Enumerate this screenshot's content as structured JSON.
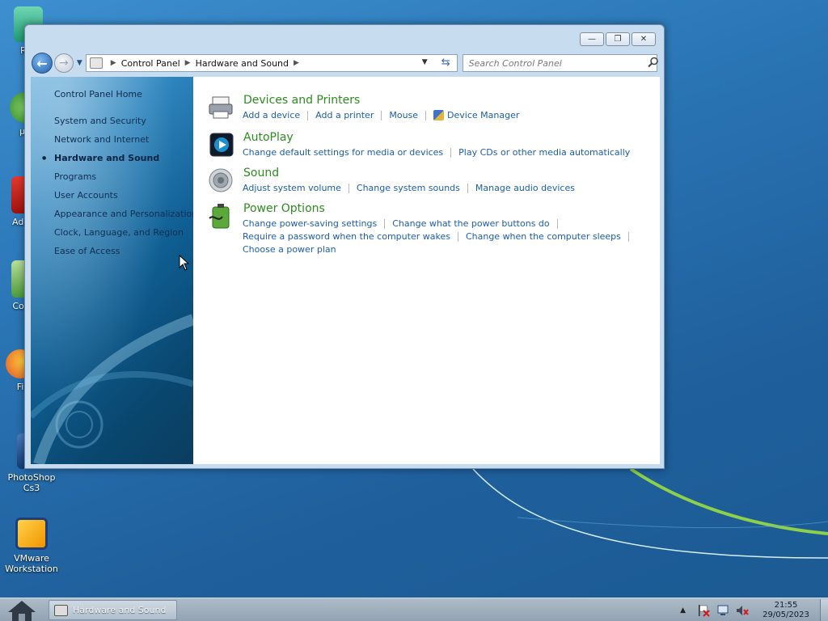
{
  "desktop": {
    "icons": [
      {
        "label": "Rec",
        "color": "#2fb88a"
      },
      {
        "label": "µT",
        "color": "#43a14b"
      },
      {
        "label": "Adob",
        "color": "#c8201c"
      },
      {
        "label": "Colla",
        "color": "#59a84a"
      },
      {
        "label": "Fi",
        "color": "#e8762a"
      },
      {
        "label": "PhotoShop Cs3",
        "color": "#1c4c8a"
      },
      {
        "label": "VMware Workstation",
        "color": "#f2a21a"
      }
    ]
  },
  "window": {
    "controls": {
      "minimize": "—",
      "restore": "❐",
      "close": "✕"
    },
    "address": {
      "crumbs": [
        "Control Panel",
        "Hardware and Sound"
      ]
    },
    "search": {
      "placeholder": "Search Control Panel"
    },
    "left": {
      "home": "Control Panel Home",
      "items": [
        "System and Security",
        "Network and Internet",
        "Hardware and Sound",
        "Programs",
        "User Accounts",
        "Appearance and Personalization",
        "Clock, Language, and Region",
        "Ease of Access"
      ],
      "selected_index": 2
    },
    "categories": [
      {
        "title": "Devices and Printers",
        "icon": "printer-icon",
        "links": [
          [
            "Add a device",
            "Add a printer",
            "Mouse",
            "Device Manager"
          ]
        ]
      },
      {
        "title": "AutoPlay",
        "icon": "autoplay-icon",
        "links": [
          [
            "Change default settings for media or devices",
            "Play CDs or other media automatically"
          ]
        ]
      },
      {
        "title": "Sound",
        "icon": "speaker-icon",
        "links": [
          [
            "Adjust system volume",
            "Change system sounds",
            "Manage audio devices"
          ]
        ]
      },
      {
        "title": "Power Options",
        "icon": "battery-icon",
        "links": [
          [
            "Change power-saving settings",
            "Change what the power buttons do"
          ],
          [
            "Require a password when the computer wakes",
            "Change when the computer sleeps"
          ],
          [
            "Choose a power plan"
          ]
        ]
      }
    ]
  },
  "taskbar": {
    "task_label": "Hardware and Sound",
    "clock_time": "21:55",
    "clock_date": "29/05/2023"
  }
}
